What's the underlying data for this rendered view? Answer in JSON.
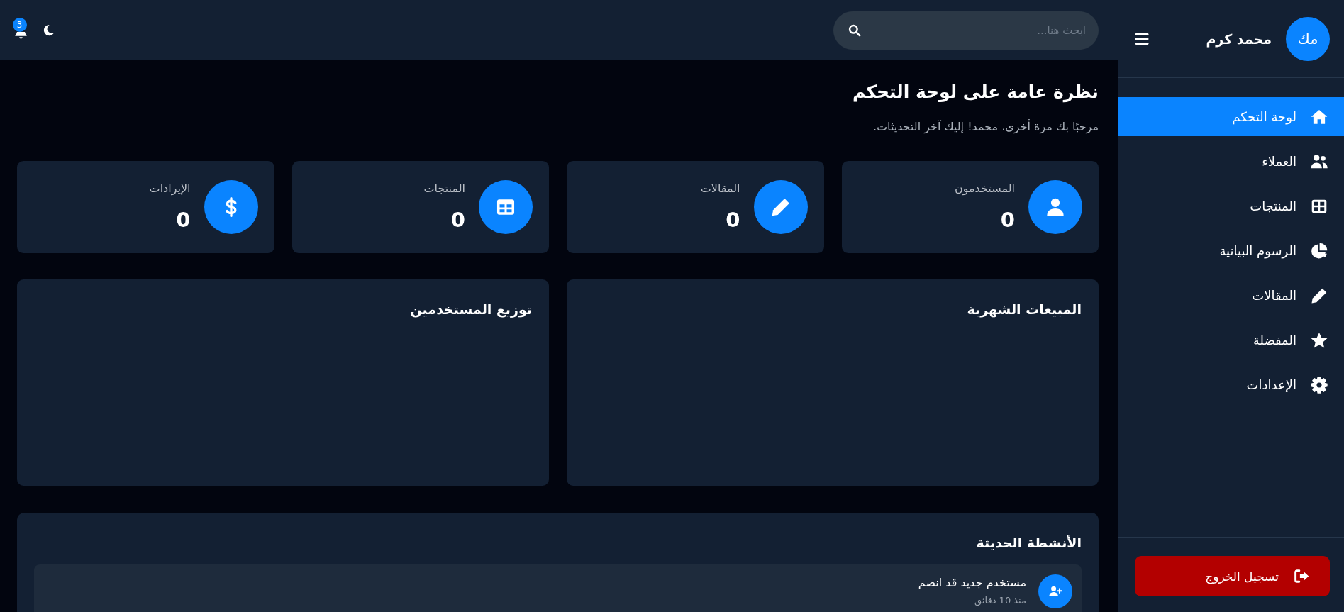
{
  "sidebar": {
    "user": {
      "initials": "مك",
      "name": "محمد كرم"
    },
    "items": [
      {
        "kind": "dashboard",
        "label": "لوحة التحكم",
        "selected": true
      },
      {
        "kind": "customers",
        "label": "العملاء",
        "selected": false
      },
      {
        "kind": "products",
        "label": "المنتجات",
        "selected": false
      },
      {
        "kind": "charts",
        "label": "الرسوم البيانية",
        "selected": false
      },
      {
        "kind": "articles",
        "label": "المقالات",
        "selected": false
      },
      {
        "kind": "favorites",
        "label": "المفضلة",
        "selected": false
      },
      {
        "kind": "settings",
        "label": "الإعدادات",
        "selected": false
      }
    ],
    "logout": "تسجيل الخروج"
  },
  "topbar": {
    "search": {
      "placeholder": "ابحث هنا..."
    },
    "notifications": {
      "count": "3"
    }
  },
  "header": {
    "title": "نظرة عامة على لوحة التحكم",
    "subtitle": "مرحبًا بك مرة أخرى، محمد! إليك آخر التحديثات."
  },
  "stats": [
    {
      "kind": "users",
      "label": "المستخدمون",
      "value": "0"
    },
    {
      "kind": "articles",
      "label": "المقالات",
      "value": "0"
    },
    {
      "kind": "products",
      "label": "المنتجات",
      "value": "0"
    },
    {
      "kind": "revenue",
      "label": "الإيرادات",
      "value": "0"
    }
  ],
  "charts": [
    {
      "title": "المبيعات الشهرية"
    },
    {
      "title": "توزيع المستخدمين"
    }
  ],
  "activity": {
    "title": "الأنشطة الحديثة",
    "items": [
      {
        "kind": "signup",
        "text": "مستخدم جديد قد انضم",
        "time": "منذ 10 دقائق"
      }
    ]
  }
}
